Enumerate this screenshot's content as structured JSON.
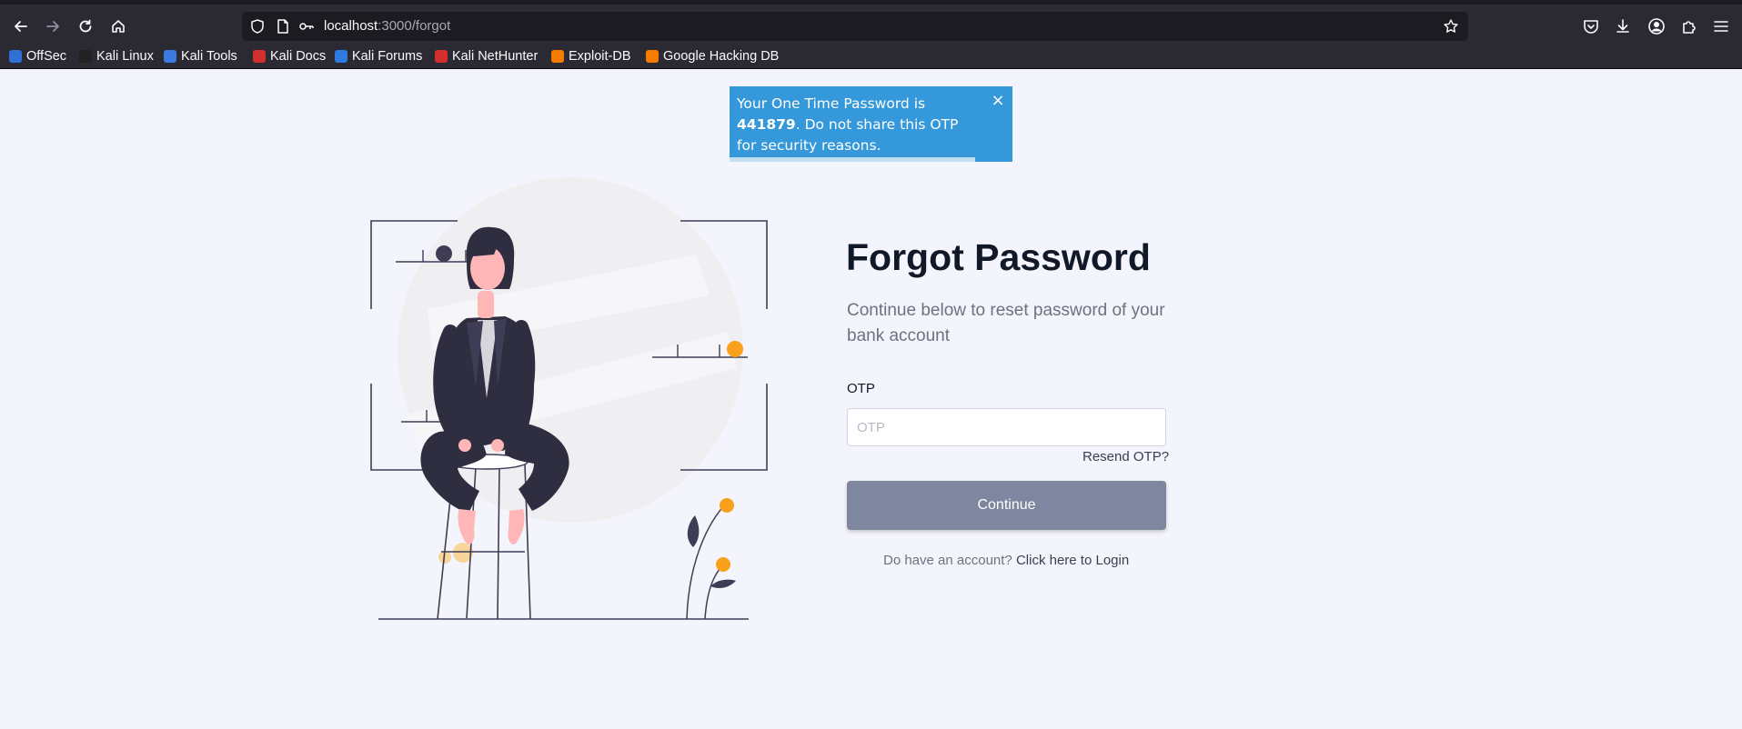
{
  "browser": {
    "url_host": "localhost",
    "url_path": ":3000/forgot",
    "bookmarks": [
      {
        "label": "OffSec",
        "color": "#2f6fd6"
      },
      {
        "label": "Kali Linux",
        "color": "#222222"
      },
      {
        "label": "Kali Tools",
        "color": "#3b7be0"
      },
      {
        "label": "Kali Docs",
        "color": "#d32f2f"
      },
      {
        "label": "Kali Forums",
        "color": "#2d7be0"
      },
      {
        "label": "Kali NetHunter",
        "color": "#d32f2f"
      },
      {
        "label": "Exploit-DB",
        "color": "#f57c00"
      },
      {
        "label": "Google Hacking DB",
        "color": "#f57c00"
      }
    ]
  },
  "toast": {
    "text_before": "Your One Time Password is ",
    "otp": "441879",
    "text_after": ". Do not share this OTP for security reasons.",
    "close": "×",
    "color": "#3498db"
  },
  "form": {
    "title": "Forgot Password",
    "subtitle": "Continue below to reset password of your bank account",
    "otp_label": "OTP",
    "otp_placeholder": "OTP",
    "otp_value": "",
    "resend": "Resend OTP?",
    "continue": "Continue",
    "account_text": "Do have an account?",
    "login_link": "Click here to Login"
  }
}
